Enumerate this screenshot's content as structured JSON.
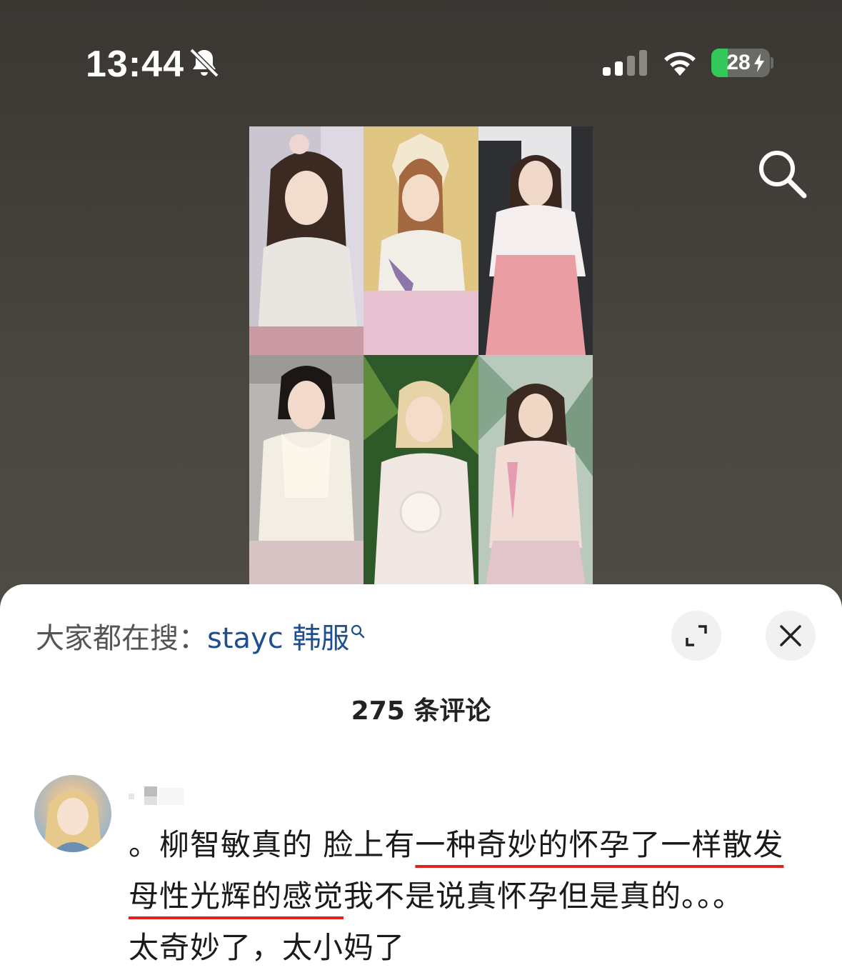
{
  "status_bar": {
    "time": "13:44",
    "battery_percent": "28",
    "battery_level": 0.28,
    "icons": [
      "bell-slash-icon",
      "cellular-signal-icon",
      "wifi-icon",
      "battery-charging-icon"
    ]
  },
  "header": {
    "search_icon": "search-icon"
  },
  "post": {
    "image_grid_count": 6
  },
  "sheet": {
    "search_prefix": "大家都在搜：",
    "search_term": "stayc 韩服",
    "expand_icon": "expand-icon",
    "close_icon": "close-icon",
    "comment_count": "275 条评论"
  },
  "comment": {
    "text_part1": "。柳智敏真的 脸上有",
    "text_highlight1": "一种奇妙的怀孕了一样散发",
    "text_highlight2": "母性光辉的感觉",
    "text_part2": "我不是说真怀孕但是真的。。。",
    "text_part3": "太奇妙了，太小妈了"
  },
  "colors": {
    "accent_link": "#1f4f8f",
    "underline": "#e02424",
    "battery_green": "#34c759"
  }
}
